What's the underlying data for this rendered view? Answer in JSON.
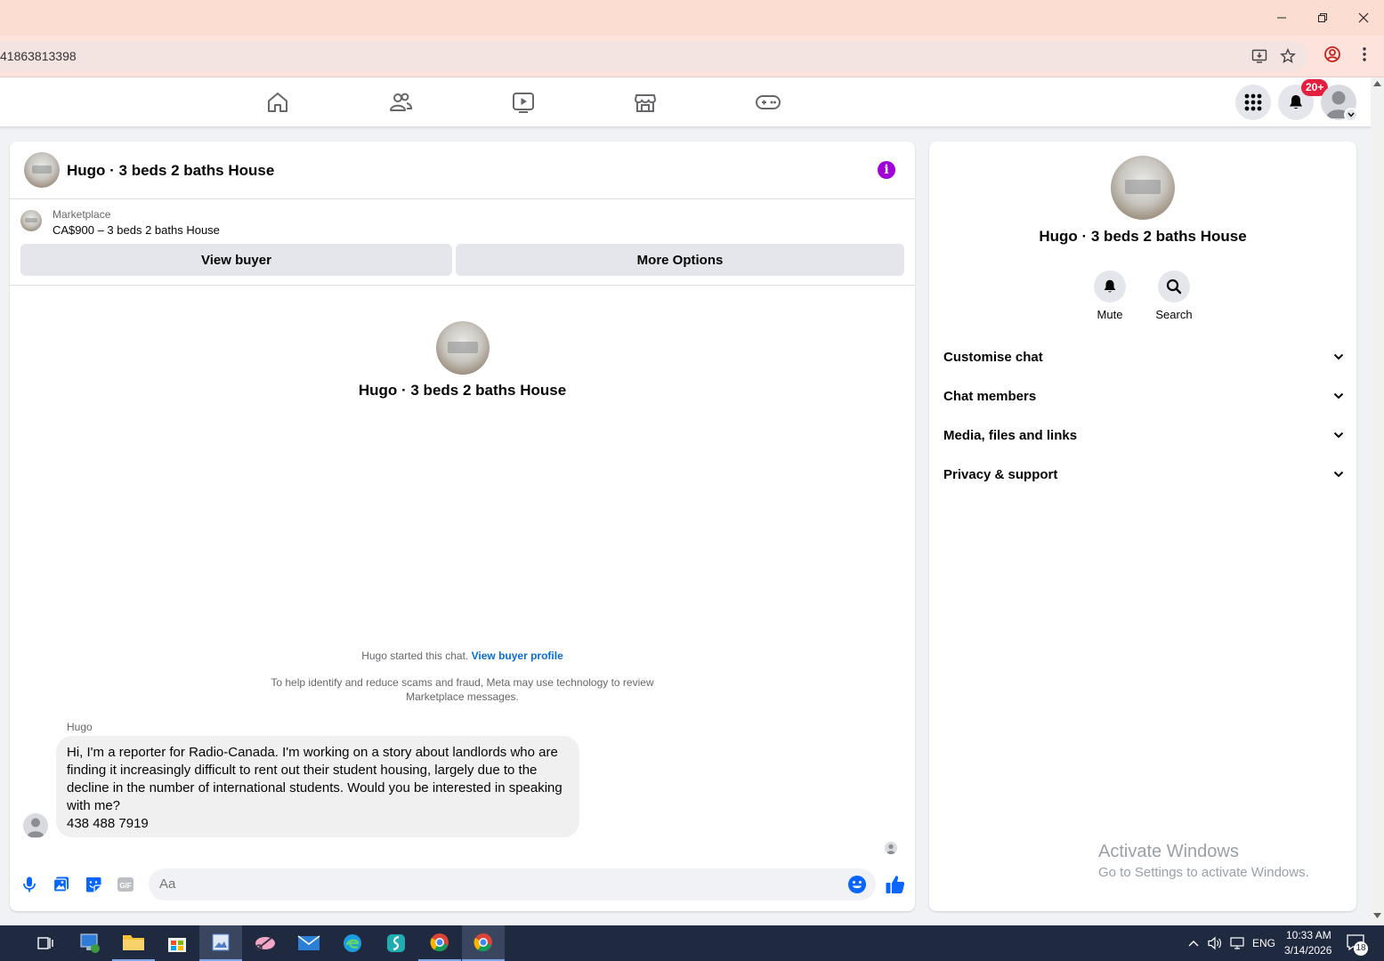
{
  "browser": {
    "url_fragment": "41863813398"
  },
  "fbnav": {
    "notifications_badge": "20+"
  },
  "chat": {
    "title": "Hugo · 3 beds 2 baths House",
    "marketplace_label": "Marketplace",
    "listing": "CA$900 – 3 beds 2 baths House",
    "view_buyer_label": "View buyer",
    "more_options_label": "More Options",
    "center_name": "Hugo · 3 beds 2 baths House",
    "started_text": "Hugo started this chat.",
    "view_buyer_profile_link": "View buyer profile",
    "scam_notice_line1": "To help identify and reduce scams and fraud, Meta may use technology to review",
    "scam_notice_line2": "Marketplace messages.",
    "sender_name": "Hugo",
    "message_lines": [
      "Hi, I'm a reporter for Radio-Canada. I'm working on a story about landlords who are",
      "finding it increasingly difficult to rent out their student housing, largely due to the",
      "decline in the number of international students. Would you be interested in speaking",
      "with me?",
      "438 488 7919"
    ],
    "composer_placeholder": "Aa"
  },
  "info_panel": {
    "name": "Hugo · 3 beds 2 baths House",
    "mute_label": "Mute",
    "search_label": "Search",
    "sections": [
      "Customise chat",
      "Chat members",
      "Media, files and links",
      "Privacy & support"
    ],
    "watermark_line1": "Activate Windows",
    "watermark_line2": "Go to Settings to activate Windows."
  },
  "taskbar": {
    "language": "ENG",
    "time": "10:33 AM",
    "date": "3/14/2026",
    "notification_count": "18"
  },
  "colors": {
    "titlebar": "#fcddd2",
    "accent_blue": "#0866ff",
    "info_purple": "#a100d6",
    "badge_red": "#e41e3f"
  }
}
